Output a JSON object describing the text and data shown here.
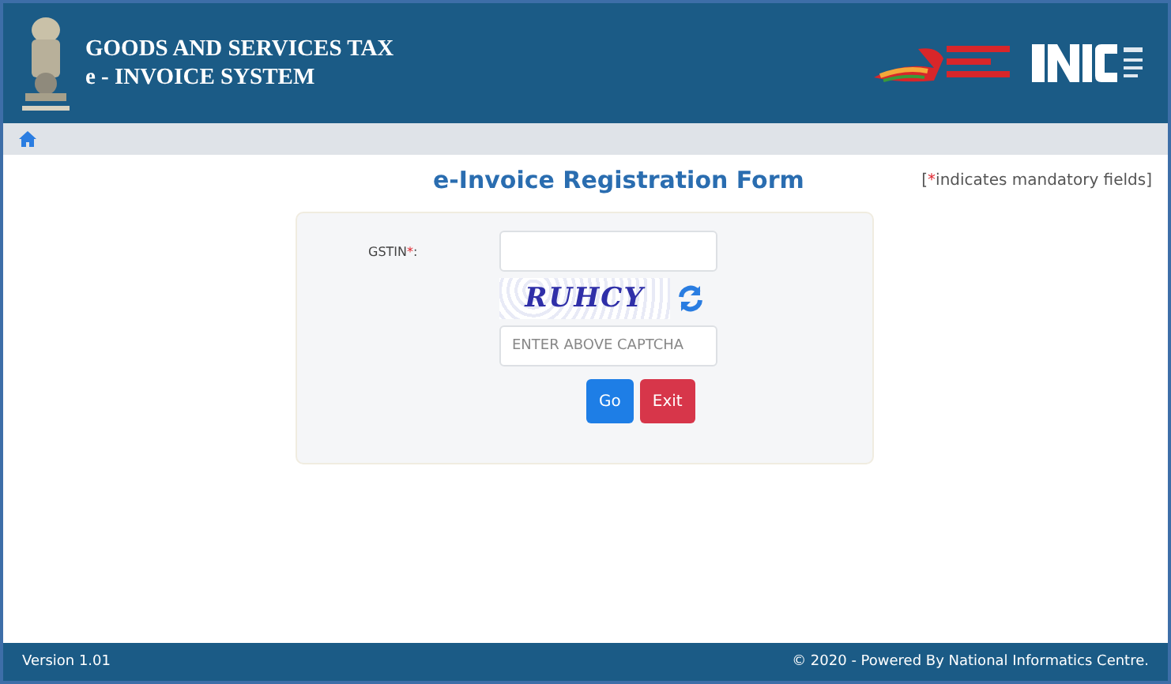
{
  "header": {
    "title_line_1": "GOODS AND SERVICES TAX",
    "title_line_2": "e - INVOICE SYSTEM"
  },
  "form": {
    "title": "e-Invoice Registration Form",
    "mandatory_note": {
      "open": "[",
      "star": "*",
      "text": "indicates mandatory fields]"
    },
    "gstin_label": "GSTIN",
    "required_mark": "*",
    "label_colon": ":",
    "captcha_text": "RUHCY",
    "captcha_placeholder": "ENTER ABOVE CAPTCHA",
    "buttons": [
      {
        "label": "Go",
        "kind": "primary"
      },
      {
        "label": "Exit",
        "kind": "danger"
      }
    ]
  },
  "status_bar": {
    "version": "Version 1.01",
    "credit": "© 2020 - Powered By National Informatics Centre."
  }
}
